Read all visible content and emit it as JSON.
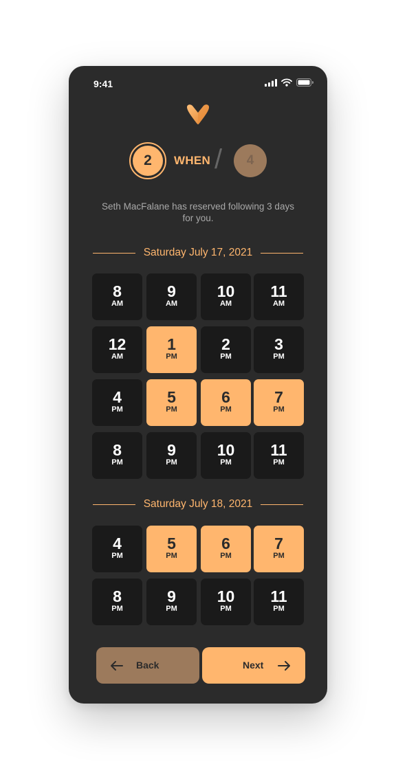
{
  "status_bar": {
    "time": "9:41",
    "icons": [
      "cellular-signal-icon",
      "wifi-icon",
      "battery-icon"
    ]
  },
  "logo": "brand-v-logo-icon",
  "stepper": {
    "current_step": "2",
    "step_label": "WHEN",
    "separator": "/",
    "total_steps": "4"
  },
  "subtitle": "Seth MacFalane has reserved following 3 days for you.",
  "days": [
    {
      "date": "Saturday July 17, 2021",
      "slots": [
        {
          "hour": "8",
          "period": "AM",
          "selected": false
        },
        {
          "hour": "9",
          "period": "AM",
          "selected": false
        },
        {
          "hour": "10",
          "period": "AM",
          "selected": false
        },
        {
          "hour": "11",
          "period": "AM",
          "selected": false
        },
        {
          "hour": "12",
          "period": "AM",
          "selected": false
        },
        {
          "hour": "1",
          "period": "PM",
          "selected": true
        },
        {
          "hour": "2",
          "period": "PM",
          "selected": false
        },
        {
          "hour": "3",
          "period": "PM",
          "selected": false
        },
        {
          "hour": "4",
          "period": "PM",
          "selected": false
        },
        {
          "hour": "5",
          "period": "PM",
          "selected": true
        },
        {
          "hour": "6",
          "period": "PM",
          "selected": true
        },
        {
          "hour": "7",
          "period": "PM",
          "selected": true
        },
        {
          "hour": "8",
          "period": "PM",
          "selected": false
        },
        {
          "hour": "9",
          "period": "PM",
          "selected": false
        },
        {
          "hour": "10",
          "period": "PM",
          "selected": false
        },
        {
          "hour": "11",
          "period": "PM",
          "selected": false
        }
      ]
    },
    {
      "date": "Saturday July 18, 2021",
      "slots": [
        {
          "hour": "4",
          "period": "PM",
          "selected": false
        },
        {
          "hour": "5",
          "period": "PM",
          "selected": true
        },
        {
          "hour": "6",
          "period": "PM",
          "selected": true
        },
        {
          "hour": "7",
          "period": "PM",
          "selected": true
        },
        {
          "hour": "8",
          "period": "PM",
          "selected": false
        },
        {
          "hour": "9",
          "period": "PM",
          "selected": false
        },
        {
          "hour": "10",
          "period": "PM",
          "selected": false
        },
        {
          "hour": "11",
          "period": "PM",
          "selected": false
        }
      ]
    }
  ],
  "buttons": {
    "back_label": "Back",
    "next_label": "Next",
    "back_icon": "arrow-left-icon",
    "next_icon": "arrow-right-icon"
  },
  "colors": {
    "accent": "#ffb66e",
    "accent_muted": "#9c7a5c",
    "background": "#2b2b2b",
    "slot": "#1a1a1a"
  }
}
